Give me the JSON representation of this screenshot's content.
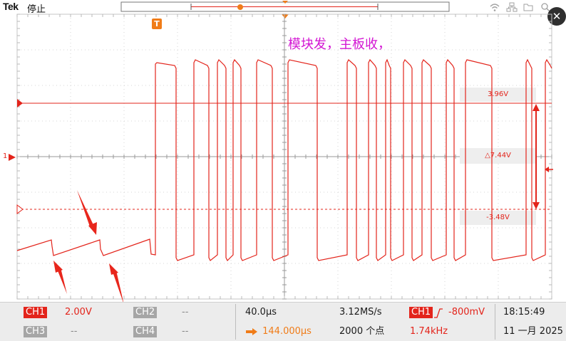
{
  "header": {
    "brand": "Tek",
    "state": "停止"
  },
  "trigger_badge": "T",
  "annotation": "模块发，主板收，",
  "channel_marker": "1",
  "cursors": {
    "upper_value": "3.96V",
    "delta_value": "△7.44V",
    "lower_value": "-3.48V"
  },
  "status": {
    "ch1_label": "CH1",
    "ch1_scale": "2.00V",
    "ch2_label": "CH2",
    "ch2_value": "--",
    "ch3_label": "CH3",
    "ch3_value": "--",
    "ch4_label": "CH4",
    "ch4_value": "--",
    "timebase": "40.0µs",
    "sample_rate": "3.12MS/s",
    "horizontal_position": "144.000µs",
    "record_length": "2000 个点",
    "trigger_source": "CH1",
    "trigger_level": "-800mV",
    "frequency": "1.74kHz",
    "time": "18:15:49",
    "date": "11 一月 2025"
  },
  "icons": [
    "wifi-icon",
    "network-icon",
    "folder-icon",
    "search-icon",
    "close-icon"
  ],
  "colors": {
    "trace": "#e3241b",
    "annotation": "#d316d3",
    "trigger": "#f07c18"
  }
}
